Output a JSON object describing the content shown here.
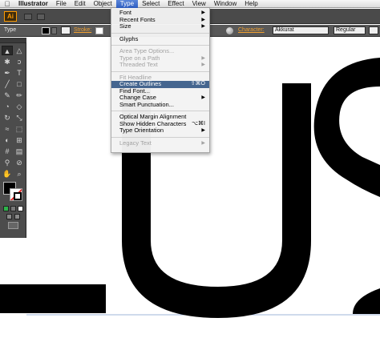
{
  "menubar": {
    "apple": "",
    "items": [
      "Illustrator",
      "File",
      "Edit",
      "Object",
      "Type",
      "Select",
      "Effect",
      "View",
      "Window",
      "Help"
    ],
    "active": "Type"
  },
  "appbar": {
    "logo": "Ai"
  },
  "control_bar": {
    "selection_label": "Type",
    "stroke_label": "Stroke:",
    "character_label": "Character:",
    "font_family": "Akkurat",
    "font_style": "Regular"
  },
  "type_menu": {
    "items": [
      {
        "label": "Font",
        "submenu": true,
        "disabled": false
      },
      {
        "label": "Recent Fonts",
        "submenu": true,
        "disabled": false
      },
      {
        "label": "Size",
        "submenu": true,
        "disabled": false
      },
      {
        "separator": true
      },
      {
        "label": "Glyphs",
        "disabled": false
      },
      {
        "separator": true
      },
      {
        "label": "Area Type Options...",
        "disabled": true
      },
      {
        "label": "Type on a Path",
        "submenu": true,
        "disabled": true
      },
      {
        "label": "Threaded Text",
        "submenu": true,
        "disabled": true
      },
      {
        "separator": true
      },
      {
        "label": "Fit Headline",
        "disabled": true
      },
      {
        "label": "Create Outlines",
        "shortcut": "⇧⌘O",
        "disabled": false,
        "highlighted": true
      },
      {
        "label": "Find Font...",
        "disabled": false
      },
      {
        "label": "Change Case",
        "submenu": true,
        "disabled": false
      },
      {
        "label": "Smart Punctuation...",
        "disabled": false
      },
      {
        "separator": true
      },
      {
        "label": "Optical Margin Alignment",
        "disabled": false
      },
      {
        "label": "Show Hidden Characters",
        "shortcut": "⌥⌘I",
        "disabled": false
      },
      {
        "label": "Type Orientation",
        "submenu": true,
        "disabled": false
      },
      {
        "separator": true
      },
      {
        "label": "Legacy Text",
        "submenu": true,
        "disabled": true
      }
    ]
  },
  "tools": {
    "icons": [
      "selection-tool",
      "direct-selection-tool",
      "magic-wand-tool",
      "lasso-tool",
      "pen-tool",
      "type-tool",
      "line-tool",
      "rectangle-tool",
      "paintbrush-tool",
      "pencil-tool",
      "blob-brush-tool",
      "eraser-tool",
      "rotate-tool",
      "scale-tool",
      "width-tool",
      "free-transform-tool",
      "shape-builder-tool",
      "perspective-grid-tool",
      "mesh-tool",
      "gradient-tool",
      "eyedropper-tool",
      "blend-tool",
      "symbol-sprayer-tool",
      "column-graph-tool",
      "artboard-tool",
      "slice-tool",
      "hand-tool",
      "zoom-tool"
    ]
  },
  "canvas": {
    "text": "LUS",
    "fill_color": "#000000"
  }
}
